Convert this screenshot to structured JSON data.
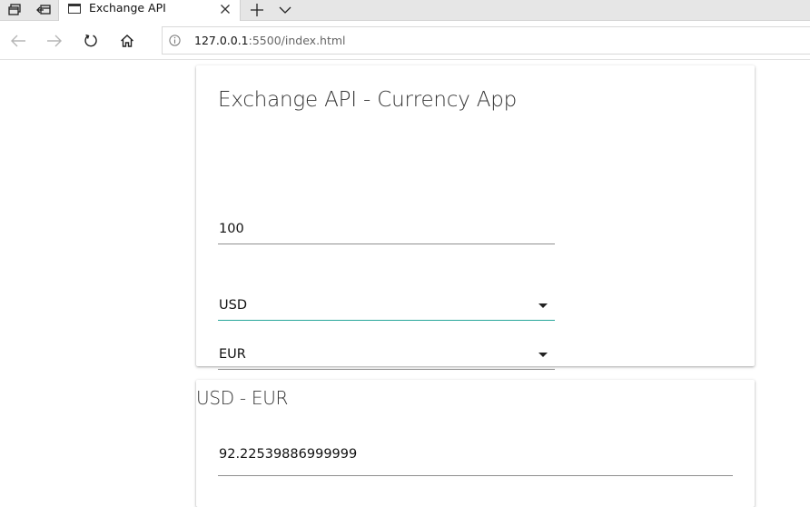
{
  "browser": {
    "tab": {
      "title": "Exchange API",
      "icon": "page-icon"
    },
    "toolbar_icons": [
      "tab-preview-icon",
      "tabs-aside-icon",
      "close-icon",
      "plus-icon",
      "chevron-down-icon"
    ],
    "nav": {
      "back_icon": "arrow-left-icon",
      "forward_icon": "arrow-right-icon",
      "refresh_icon": "refresh-icon",
      "home_icon": "home-icon",
      "info_icon": "info-icon"
    },
    "url": {
      "host": "127.0.0.1",
      "rest": ":5500/index.html"
    }
  },
  "app": {
    "title": "Exchange API - Currency App",
    "amount": "100",
    "from_currency": "USD",
    "to_currency": "EUR",
    "accent_color": "#26a69a"
  },
  "result": {
    "title": "USD - EUR",
    "value": "92.22539886999999"
  }
}
